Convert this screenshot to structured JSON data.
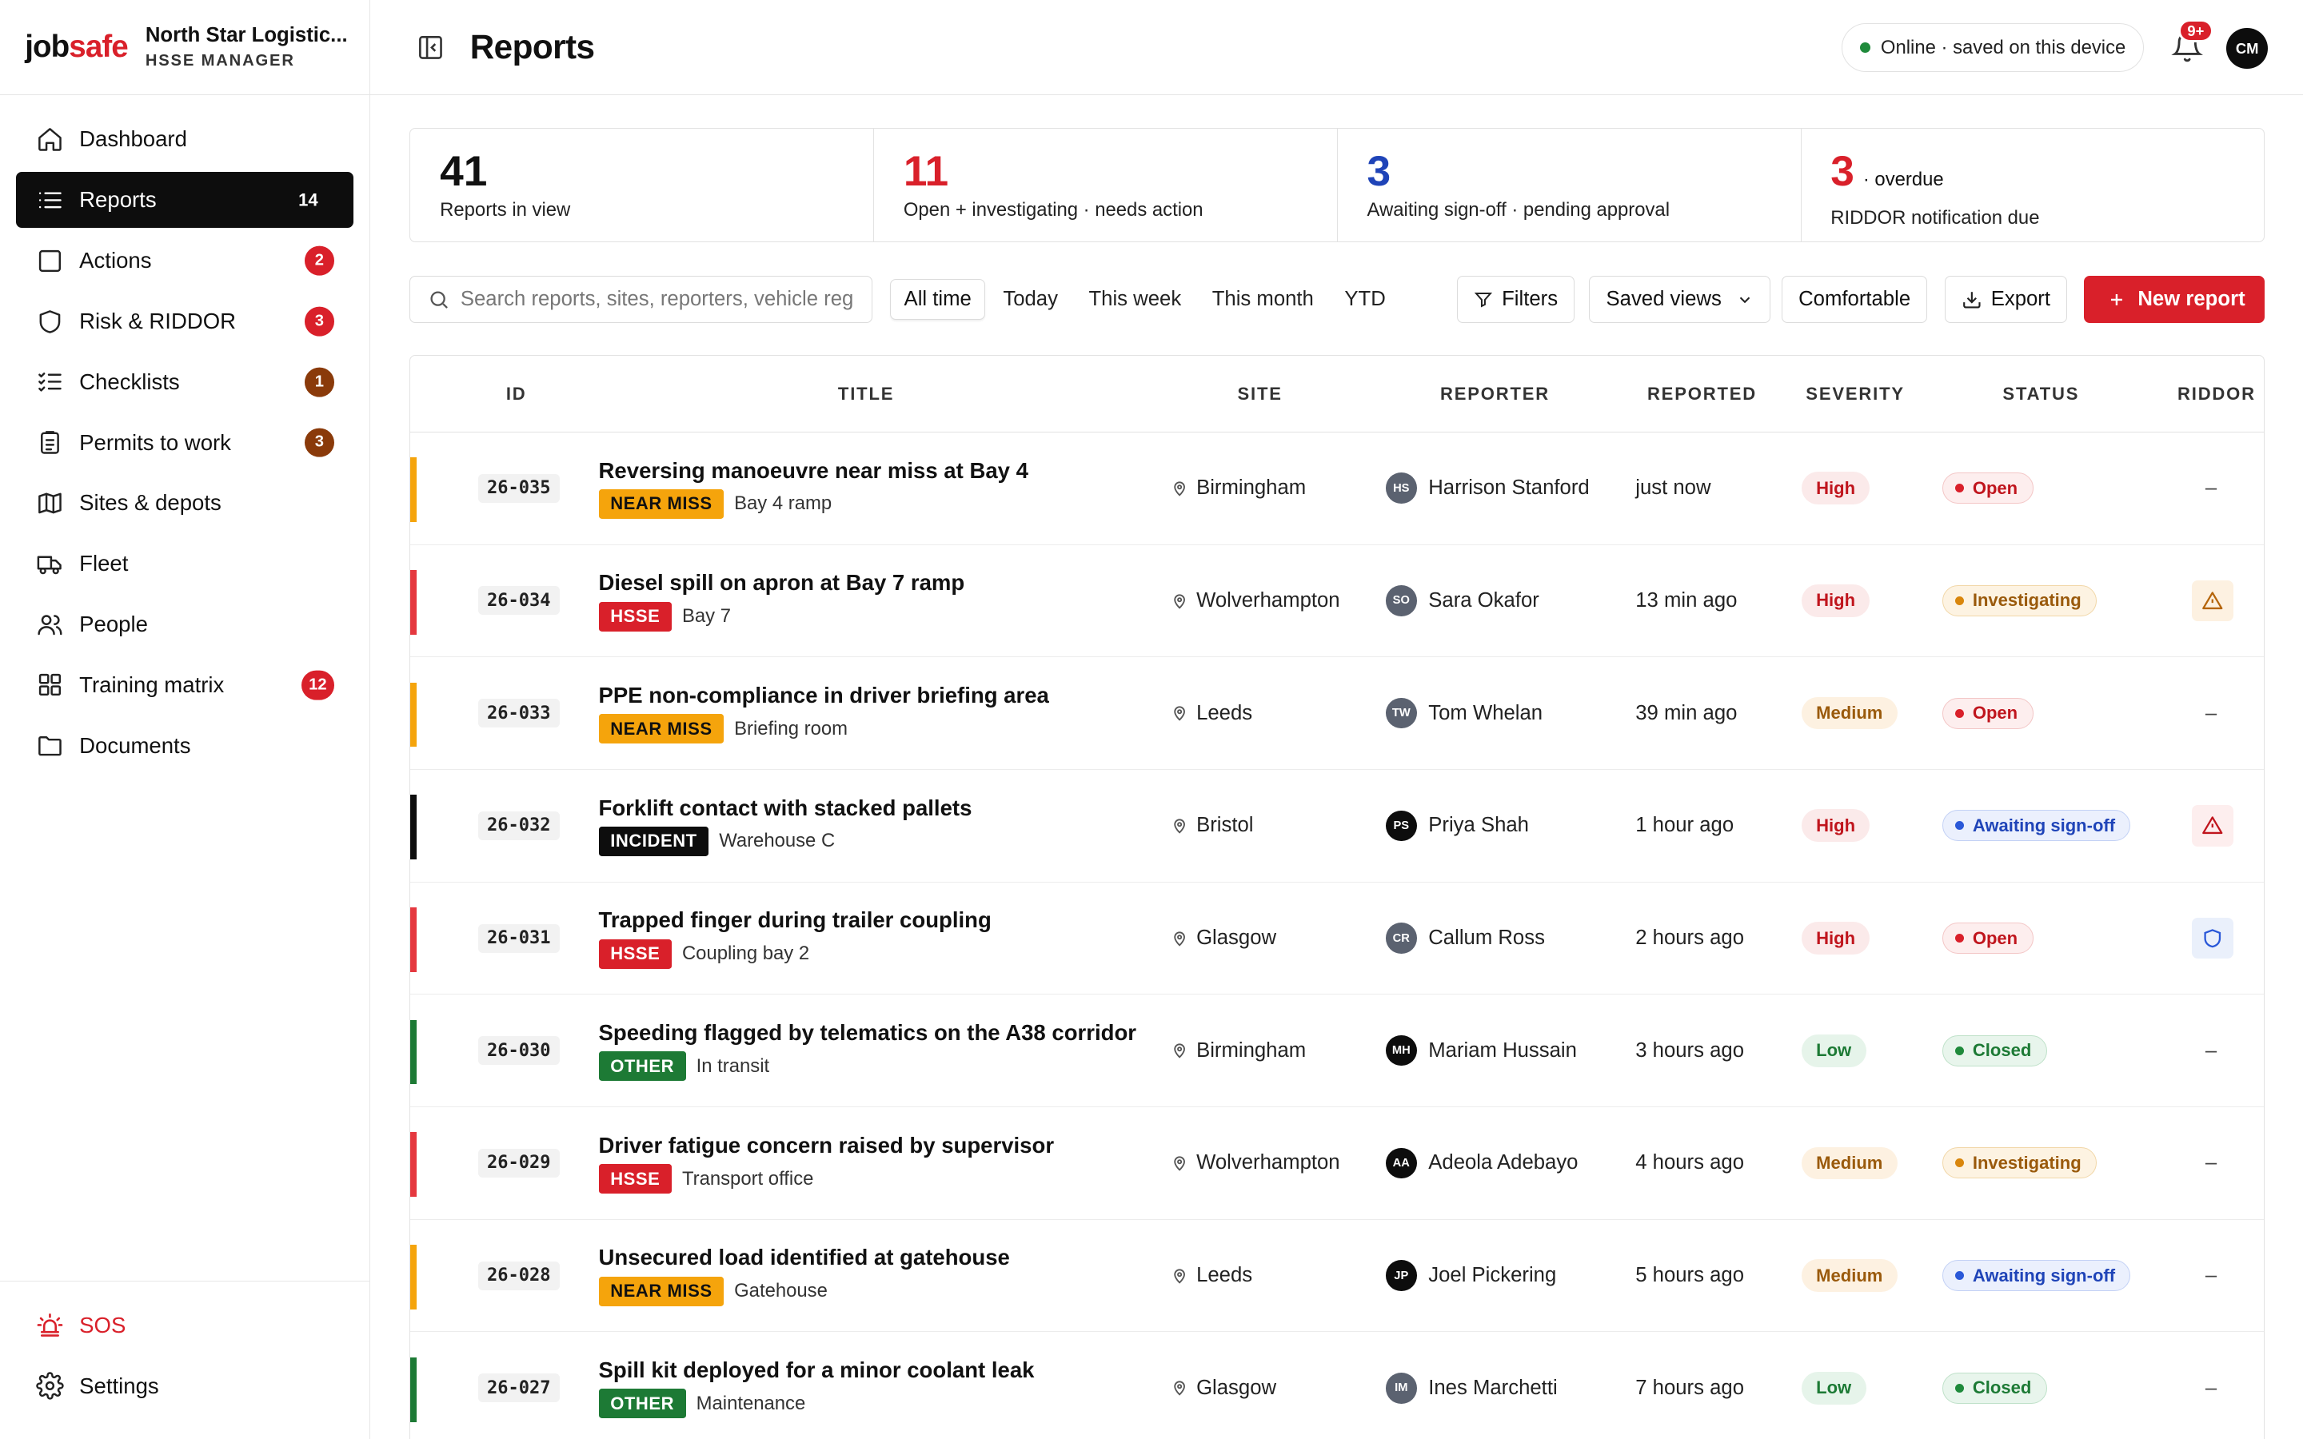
{
  "brand": {
    "logo_job": "job",
    "logo_safe": "safe",
    "org_name": "North Star Logistic...",
    "role": "HSSE MANAGER"
  },
  "nav": [
    {
      "label": "Dashboard",
      "icon": "home-icon",
      "count": "",
      "active": false
    },
    {
      "label": "Reports",
      "icon": "list-icon",
      "count": "14",
      "active": true
    },
    {
      "label": "Actions",
      "icon": "square-icon",
      "count": "2",
      "active": false,
      "count_color": "#d9202a"
    },
    {
      "label": "Risk & RIDDOR",
      "icon": "shield-icon",
      "count": "3",
      "active": false,
      "count_color": "#d9202a"
    },
    {
      "label": "Checklists",
      "icon": "checklist-icon",
      "count": "1",
      "active": false,
      "count_color": "#8a3a0a"
    },
    {
      "label": "Permits to work",
      "icon": "clipboard-icon",
      "count": "3",
      "active": false,
      "count_color": "#8a3a0a"
    },
    {
      "label": "Sites & depots",
      "icon": "map-icon",
      "count": "",
      "active": false
    },
    {
      "label": "Fleet",
      "icon": "truck-icon",
      "count": "",
      "active": false
    },
    {
      "label": "People",
      "icon": "people-icon",
      "count": "",
      "active": false
    },
    {
      "label": "Training matrix",
      "icon": "grid-icon",
      "count": "12",
      "active": false,
      "count_color": "#d9202a"
    },
    {
      "label": "Documents",
      "icon": "folder-icon",
      "count": "",
      "active": false
    }
  ],
  "bottom_nav": {
    "sos": "SOS",
    "settings": "Settings"
  },
  "header": {
    "title": "Reports",
    "status": "Online · saved on this device",
    "notif_count": "9+",
    "user_initials": "CM"
  },
  "stats": [
    {
      "value": "41",
      "suffix": "",
      "label": "Reports in view",
      "color": "#111111"
    },
    {
      "value": "11",
      "suffix": "",
      "label": "Open + investigating · needs action",
      "color": "#d9202a"
    },
    {
      "value": "3",
      "suffix": "",
      "label": "Awaiting sign-off · pending approval",
      "color": "#1f44b8"
    },
    {
      "value": "3",
      "suffix": "· overdue",
      "label": "RIDDOR notification due",
      "color": "#d9202a"
    }
  ],
  "toolbar": {
    "search_placeholder": "Search reports, sites, reporters, vehicle reg",
    "ranges": [
      "All time",
      "Today",
      "This week",
      "This month",
      "YTD"
    ],
    "active_range": "All time",
    "filters": "Filters",
    "saved_views": "Saved views",
    "density": "Comfortable",
    "export": "Export",
    "new_report": "New report"
  },
  "columns": {
    "id": "ID",
    "title": "TITLE",
    "site": "SITE",
    "reporter": "REPORTER",
    "reported": "REPORTED",
    "severity": "SEVERITY",
    "status": "STATUS",
    "riddor": "RIDDOR"
  },
  "rows": [
    {
      "id": "26-035",
      "title": "Reversing manoeuvre near miss at Bay 4",
      "category": "NEAR MISS",
      "cat_class": "nearmiss",
      "location": "Bay 4 ramp",
      "site": "Birmingham",
      "initials": "HS",
      "avatar_color": "#5b6270",
      "reporter": "Harrison Stanford",
      "reported": "just now",
      "severity": "High",
      "sev_class": "high",
      "status": "Open",
      "status_class": "open",
      "riddor": "–",
      "riddor_icon": "",
      "bar_color": "#f5a40c"
    },
    {
      "id": "26-034",
      "title": "Diesel spill on apron at Bay 7 ramp",
      "category": "HSSE",
      "cat_class": "hsse",
      "location": "Bay 7",
      "site": "Wolverhampton",
      "initials": "SO",
      "avatar_color": "#5b6270",
      "reporter": "Sara Okafor",
      "reported": "13 min ago",
      "severity": "High",
      "sev_class": "high",
      "status": "Investigating",
      "status_class": "investigating",
      "riddor": "",
      "riddor_icon": "warning-amber",
      "bar_color": "#e5383f"
    },
    {
      "id": "26-033",
      "title": "PPE non-compliance in driver briefing area",
      "category": "NEAR MISS",
      "cat_class": "nearmiss",
      "location": "Briefing room",
      "site": "Leeds",
      "initials": "TW",
      "avatar_color": "#5b6270",
      "reporter": "Tom Whelan",
      "reported": "39 min ago",
      "severity": "Medium",
      "sev_class": "medium",
      "status": "Open",
      "status_class": "open",
      "riddor": "–",
      "riddor_icon": "",
      "bar_color": "#f5a40c"
    },
    {
      "id": "26-032",
      "title": "Forklift contact with stacked pallets",
      "category": "INCIDENT",
      "cat_class": "incident",
      "location": "Warehouse C",
      "site": "Bristol",
      "initials": "PS",
      "avatar_color": "#0d0d0d",
      "reporter": "Priya Shah",
      "reported": "1 hour ago",
      "severity": "High",
      "sev_class": "high",
      "status": "Awaiting sign-off",
      "status_class": "awaiting",
      "riddor": "",
      "riddor_icon": "warning-red",
      "bar_color": "#0d0d0d"
    },
    {
      "id": "26-031",
      "title": "Trapped finger during trailer coupling",
      "category": "HSSE",
      "cat_class": "hsse",
      "location": "Coupling bay 2",
      "site": "Glasgow",
      "initials": "CR",
      "avatar_color": "#5b6270",
      "reporter": "Callum Ross",
      "reported": "2 hours ago",
      "severity": "High",
      "sev_class": "high",
      "status": "Open",
      "status_class": "open",
      "riddor": "",
      "riddor_icon": "shield",
      "bar_color": "#e5383f"
    },
    {
      "id": "26-030",
      "title": "Speeding flagged by telematics on the A38 corridor",
      "category": "OTHER",
      "cat_class": "other",
      "location": "In transit",
      "site": "Birmingham",
      "initials": "MH",
      "avatar_color": "#0d0d0d",
      "reporter": "Mariam Hussain",
      "reported": "3 hours ago",
      "severity": "Low",
      "sev_class": "low",
      "status": "Closed",
      "status_class": "closed",
      "riddor": "–",
      "riddor_icon": "",
      "bar_color": "#1d7a35"
    },
    {
      "id": "26-029",
      "title": "Driver fatigue concern raised by supervisor",
      "category": "HSSE",
      "cat_class": "hsse",
      "location": "Transport office",
      "site": "Wolverhampton",
      "initials": "AA",
      "avatar_color": "#0d0d0d",
      "reporter": "Adeola Adebayo",
      "reported": "4 hours ago",
      "severity": "Medium",
      "sev_class": "medium",
      "status": "Investigating",
      "status_class": "investigating",
      "riddor": "–",
      "riddor_icon": "",
      "bar_color": "#e5383f"
    },
    {
      "id": "26-028",
      "title": "Unsecured load identified at gatehouse",
      "category": "NEAR MISS",
      "cat_class": "nearmiss",
      "location": "Gatehouse",
      "site": "Leeds",
      "initials": "JP",
      "avatar_color": "#0d0d0d",
      "reporter": "Joel Pickering",
      "reported": "5 hours ago",
      "severity": "Medium",
      "sev_class": "medium",
      "status": "Awaiting sign-off",
      "status_class": "awaiting",
      "riddor": "–",
      "riddor_icon": "",
      "bar_color": "#f5a40c"
    },
    {
      "id": "26-027",
      "title": "Spill kit deployed for a minor coolant leak",
      "category": "OTHER",
      "cat_class": "other",
      "location": "Maintenance",
      "site": "Glasgow",
      "initials": "IM",
      "avatar_color": "#5b6270",
      "reporter": "Ines Marchetti",
      "reported": "7 hours ago",
      "severity": "Low",
      "sev_class": "low",
      "status": "Closed",
      "status_class": "closed",
      "riddor": "–",
      "riddor_icon": "",
      "bar_color": "#1d7a35"
    }
  ]
}
